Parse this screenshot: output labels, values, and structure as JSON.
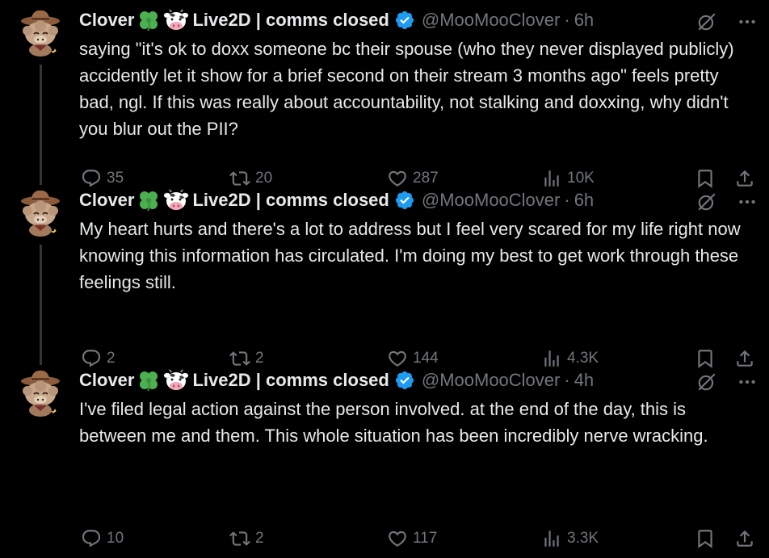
{
  "colors": {
    "background": "#000000",
    "text": "#e7e9ea",
    "secondary": "#71767b",
    "verified": "#1d9bf0",
    "thread_line": "#333639"
  },
  "tweets": [
    {
      "display_name": "Clover",
      "name_suffix": "Live2D | comms closed",
      "handle": "@MooMooClover",
      "dot": "·",
      "time": "6h",
      "text": "saying \"it's ok to doxx someone bc their spouse (who they never displayed publicly) accidently let it show for a brief second on their stream 3 months ago\" feels pretty bad, ngl. If this was really about accountability, not stalking and doxxing, why didn't you blur out the PII?",
      "replies": "35",
      "retweets": "20",
      "likes": "287",
      "views": "10K"
    },
    {
      "display_name": "Clover",
      "name_suffix": "Live2D | comms closed",
      "handle": "@MooMooClover",
      "dot": "·",
      "time": "6h",
      "text": "My heart hurts and there's a lot to address but I feel very scared for my life right now knowing this information has circulated. I'm doing my best to get work through these feelings still.",
      "replies": "2",
      "retweets": "2",
      "likes": "144",
      "views": "4.3K"
    },
    {
      "display_name": "Clover",
      "name_suffix": "Live2D | comms closed",
      "handle": "@MooMooClover",
      "dot": "·",
      "time": "4h",
      "text": "I've filed legal action against the person involved. at the end of the day, this is between me and them. This whole situation has been incredibly nerve wracking.",
      "replies": "10",
      "retweets": "2",
      "likes": "117",
      "views": "3.3K"
    }
  ],
  "icons": {
    "clover_emoji": "four-leaf-clover-icon",
    "cow_emoji": "cow-face-icon",
    "verified": "verified-badge-icon",
    "grok": "grok-icon",
    "more": "more-icon",
    "reply": "reply-icon",
    "retweet": "retweet-icon",
    "like": "like-icon",
    "views": "views-icon",
    "bookmark": "bookmark-icon",
    "share": "share-icon"
  }
}
